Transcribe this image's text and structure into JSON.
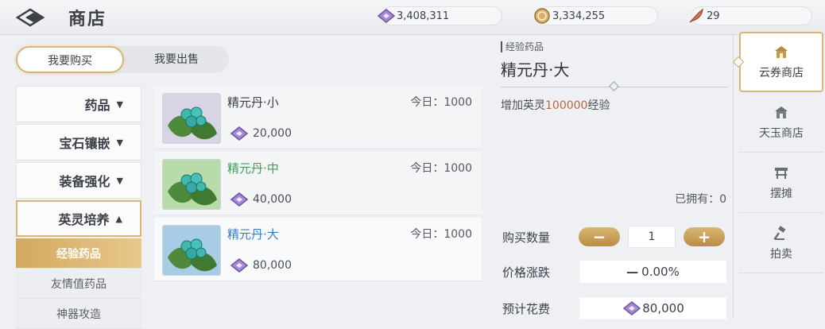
{
  "header": {
    "title": "商店",
    "currencies": [
      {
        "icon": "ticket-icon",
        "value": "3,408,311"
      },
      {
        "icon": "coin-icon",
        "value": "3,334,255"
      },
      {
        "icon": "feather-icon",
        "value": "29"
      }
    ]
  },
  "mode_tabs": [
    {
      "label": "我要购买",
      "selected": true
    },
    {
      "label": "我要出售",
      "selected": false
    }
  ],
  "categories": [
    {
      "label": "药品",
      "chevron": "chevron-down-icon"
    },
    {
      "label": "宝石镶嵌",
      "chevron": "chevron-down-icon"
    },
    {
      "label": "装备强化",
      "chevron": "chevron-down-icon"
    },
    {
      "label": "英灵培养",
      "chevron": "chevron-up-icon",
      "open": true
    }
  ],
  "subcategories": [
    {
      "label": "经验药品",
      "selected": true
    },
    {
      "label": "友情值药品",
      "selected": false
    },
    {
      "label": "神器攻造",
      "selected": false
    }
  ],
  "items": [
    {
      "name": "精元丹·小",
      "today": "今日：1000",
      "price": "20,000",
      "name_color": "#3b3f4a",
      "thumb_bg": "#d9d3e6"
    },
    {
      "name": "精元丹·中",
      "today": "今日：1000",
      "price": "40,000",
      "name_color": "#3da15a",
      "thumb_bg": "#b7dcaa"
    },
    {
      "name": "精元丹·大",
      "today": "今日：1000",
      "price": "80,000",
      "name_color": "#3a7cc4",
      "thumb_bg": "#a9cce6"
    }
  ],
  "detail": {
    "type": "经验药品",
    "name": "精元丹·大",
    "desc_prefix": "增加英灵",
    "desc_value": "100000",
    "desc_suffix": "经验",
    "owned": "已拥有：0",
    "qty_label": "购买数量",
    "qty_value": "1",
    "minus": "−",
    "plus": "+",
    "price_change_label": "价格涨跌",
    "price_change_value": "0.00%",
    "est_cost_label": "预计花费",
    "est_cost_value": "80,000"
  },
  "right_nav": [
    {
      "label": "云券商店",
      "icon": "cloud-shop-icon",
      "selected": true
    },
    {
      "label": "天玉商店",
      "icon": "jade-shop-icon",
      "selected": false
    },
    {
      "label": "摆摊",
      "icon": "stall-icon",
      "selected": false
    },
    {
      "label": "拍卖",
      "icon": "auction-hammer-icon",
      "selected": false
    }
  ],
  "colors": {
    "accent_gold": "#d4a85f",
    "highlight": "#c0633a"
  }
}
